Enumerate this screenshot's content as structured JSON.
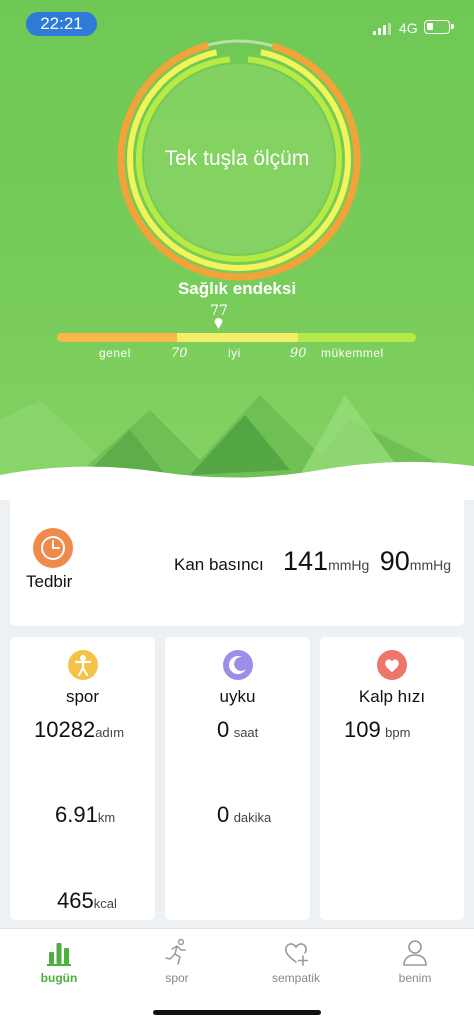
{
  "status_bar": {
    "time": "22:21",
    "network": "4G"
  },
  "measure": {
    "label": "Tek tuşla ölçüm"
  },
  "health_index": {
    "title": "Sağlık endeksi",
    "score": "77",
    "score_value": 77,
    "range": [
      50,
      110
    ],
    "labels": {
      "general": "genel",
      "good": "iyi",
      "excellent": "mükemmel"
    },
    "ticks": {
      "low": "70",
      "high": "90"
    }
  },
  "blood_pressure": {
    "name": "Tedbir",
    "title": "Kan basıncı",
    "systolic": "141",
    "systolic_unit": "mmHg",
    "diastolic": "90",
    "diastolic_unit": "mmHg"
  },
  "sport": {
    "title": "spor",
    "steps": "10282",
    "steps_unit": "adım",
    "distance": "6.91",
    "distance_unit": "km",
    "calories": "465",
    "calories_unit": "kcal"
  },
  "sleep": {
    "title": "uyku",
    "hours": "0",
    "hours_unit": "saat",
    "minutes": "0",
    "minutes_unit": "dakika"
  },
  "heart": {
    "title": "Kalp hızı",
    "rate": "109",
    "rate_unit": "bpm"
  },
  "tabs": [
    {
      "label": "bugün",
      "icon": "bar-chart-icon",
      "active": true
    },
    {
      "label": "spor",
      "icon": "running-icon",
      "active": false
    },
    {
      "label": "sempatik",
      "icon": "heart-plus-icon",
      "active": false
    },
    {
      "label": "benim",
      "icon": "person-icon",
      "active": false
    }
  ],
  "colors": {
    "hero_green": "#72c957",
    "ring_orange": "#f2a33a",
    "ring_yellow": "#f3f35a",
    "ring_lime": "#b8ea45",
    "scale_general": "#f6b84a",
    "scale_good": "#f2ee6a",
    "scale_excellent": "#b6e84a",
    "active_tab": "#4caf3e",
    "time_pill": "#2f7ad9"
  }
}
